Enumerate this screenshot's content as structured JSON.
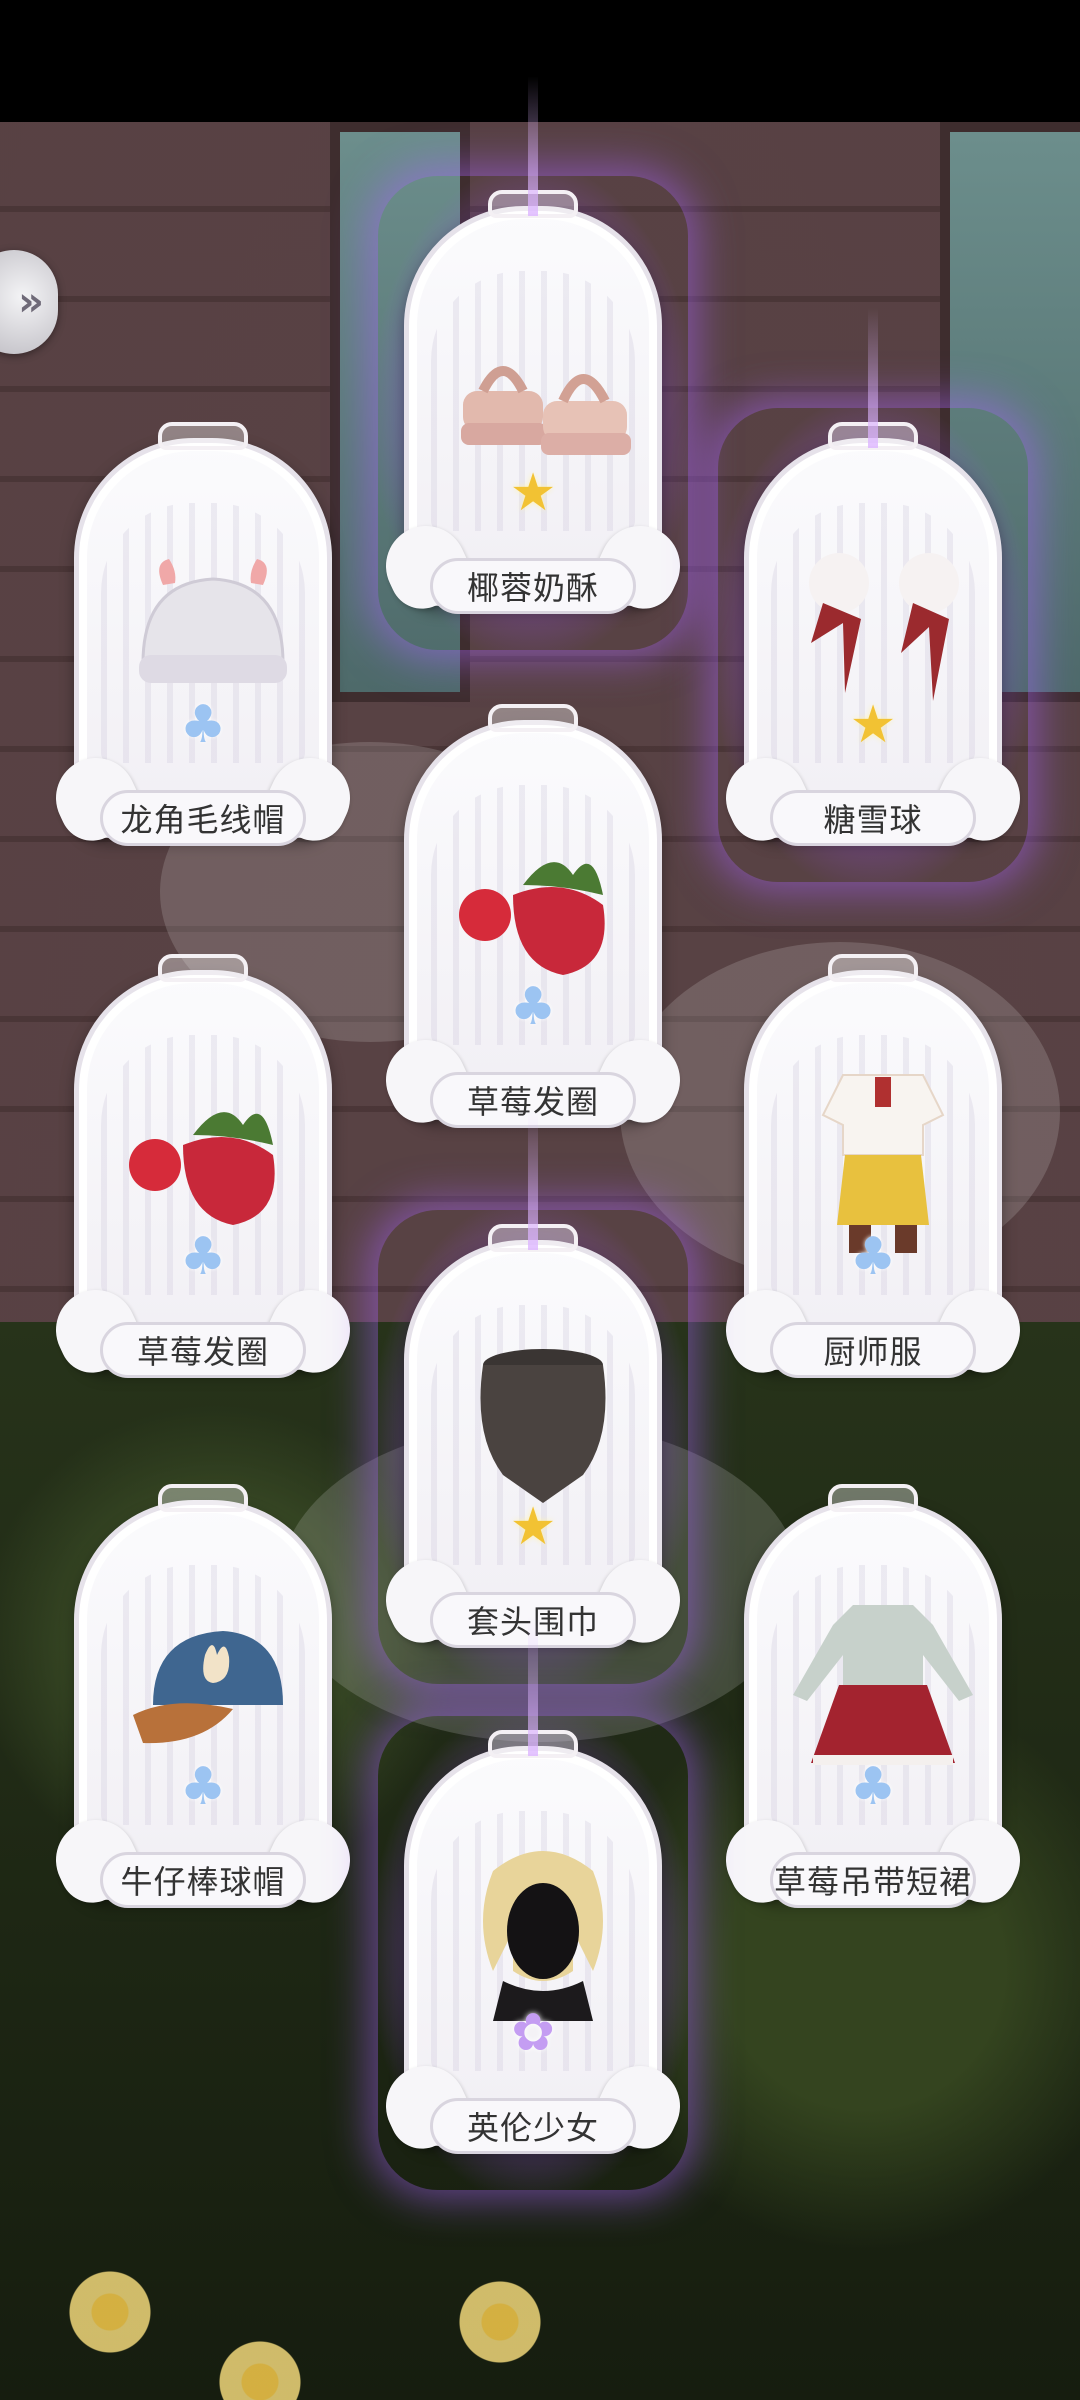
{
  "colors": {
    "glow": "#b478ff",
    "gold_star": "#f2c233",
    "blue_drop": "#9cc4f2",
    "purple_bloom": "#c49df2"
  },
  "side_button": {
    "icon": "chevron-right-icon",
    "glyph": "»"
  },
  "cards": [
    {
      "name": "椰蓉奶酥",
      "icon": "sandals-icon",
      "rarity": "gold",
      "glyph": "★"
    },
    {
      "name": "龙角毛线帽",
      "icon": "knit-hat-icon",
      "rarity": "blue",
      "glyph": "♣"
    },
    {
      "name": "糖雪球",
      "icon": "pompom-hair-ties-icon",
      "rarity": "gold",
      "glyph": "★"
    },
    {
      "name": "草莓发圈",
      "icon": "strawberry-scrunchie-icon",
      "rarity": "blue",
      "glyph": "♣"
    },
    {
      "name": "草莓发圈",
      "icon": "strawberry-scrunchie-icon",
      "rarity": "blue",
      "glyph": "♣"
    },
    {
      "name": "厨师服",
      "icon": "chef-outfit-icon",
      "rarity": "blue",
      "glyph": "♣"
    },
    {
      "name": "套头围巾",
      "icon": "snood-scarf-icon",
      "rarity": "gold",
      "glyph": "★"
    },
    {
      "name": "牛仔棒球帽",
      "icon": "denim-cap-icon",
      "rarity": "blue",
      "glyph": "♣"
    },
    {
      "name": "草莓吊带短裙",
      "icon": "strawberry-suspender-skirt-icon",
      "rarity": "blue",
      "glyph": "♣"
    },
    {
      "name": "英伦少女",
      "icon": "blonde-hair-icon",
      "rarity": "purple",
      "glyph": "✿"
    }
  ]
}
